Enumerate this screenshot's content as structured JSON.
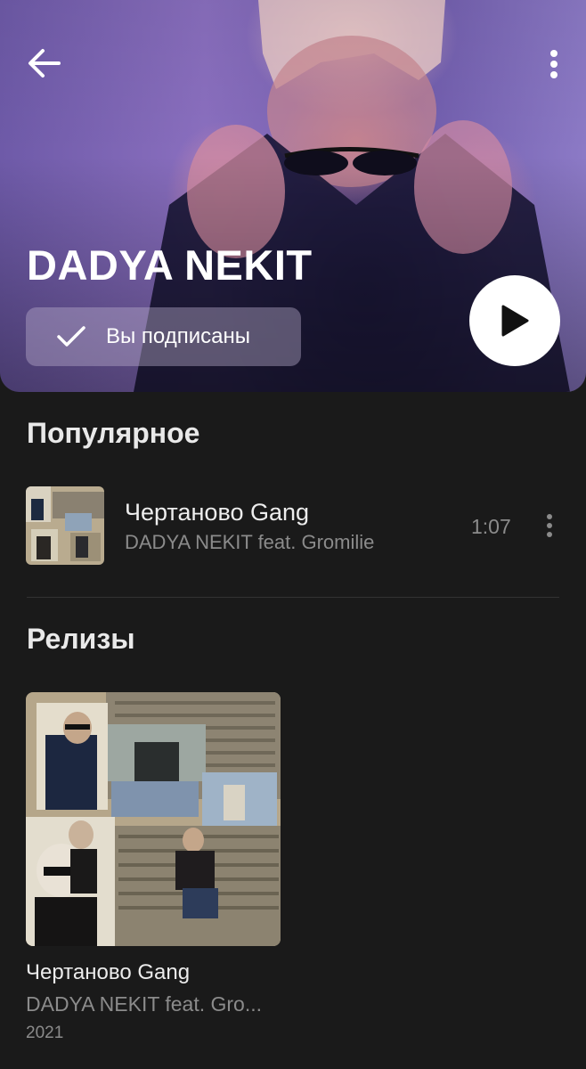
{
  "artist": {
    "name": "DADYA NEKIT",
    "subscribe_label": "Вы подписаны"
  },
  "popular": {
    "title": "Популярное",
    "tracks": [
      {
        "title": "Чертаново Gang",
        "artist": "DADYA NEKIT feat. Gromilie",
        "duration": "1:07"
      }
    ]
  },
  "releases": {
    "title": "Релизы",
    "items": [
      {
        "title": "Чертаново Gang",
        "artist": "DADYA NEKIT feat. Gro...",
        "year": "2021"
      }
    ]
  },
  "icons": {
    "back": "arrow-left-icon",
    "more": "more-vertical-icon",
    "check": "check-icon",
    "play": "play-icon"
  },
  "colors": {
    "background": "#1a1a1a",
    "text_primary": "#ededed",
    "text_secondary": "#8b8b8b"
  }
}
